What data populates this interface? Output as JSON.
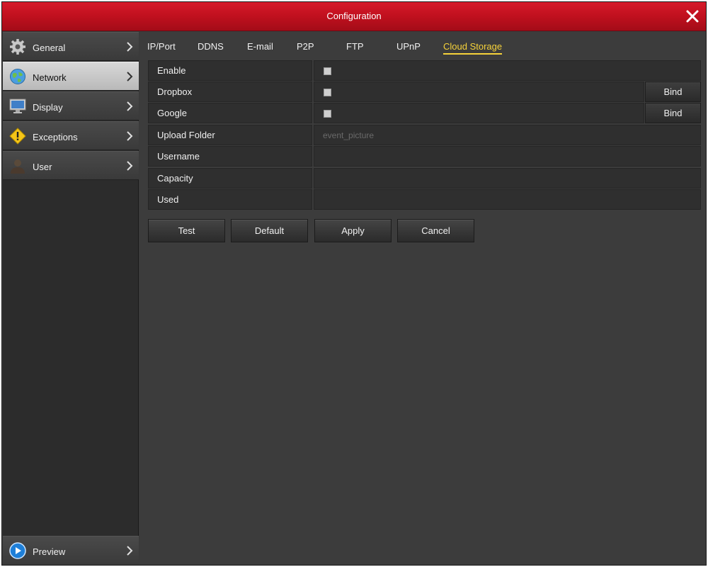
{
  "window": {
    "title": "Configuration"
  },
  "sidebar": {
    "items": [
      {
        "label": "General",
        "icon": "gear-icon"
      },
      {
        "label": "Network",
        "icon": "globe-icon",
        "active": true
      },
      {
        "label": "Display",
        "icon": "monitor-icon"
      },
      {
        "label": "Exceptions",
        "icon": "warning-icon"
      },
      {
        "label": "User",
        "icon": "user-icon"
      }
    ],
    "preview": {
      "label": "Preview",
      "icon": "play-icon"
    }
  },
  "tabs": [
    {
      "label": "IP/Port"
    },
    {
      "label": "DDNS"
    },
    {
      "label": "E-mail"
    },
    {
      "label": "P2P"
    },
    {
      "label": "FTP"
    },
    {
      "label": "UPnP"
    },
    {
      "label": "Cloud Storage",
      "active": true
    }
  ],
  "form": {
    "enable": {
      "label": "Enable",
      "checked": false
    },
    "dropbox": {
      "label": "Dropbox",
      "checked": false,
      "bind_label": "Bind"
    },
    "google": {
      "label": "Google",
      "checked": false,
      "bind_label": "Bind"
    },
    "upload_folder": {
      "label": "Upload Folder",
      "value": "event_picture"
    },
    "username": {
      "label": "Username",
      "value": ""
    },
    "capacity": {
      "label": "Capacity",
      "value": ""
    },
    "used": {
      "label": "Used",
      "value": ""
    }
  },
  "actions": {
    "test": "Test",
    "default": "Default",
    "apply": "Apply",
    "cancel": "Cancel"
  },
  "colors": {
    "titlebar": "#c0101e",
    "active_tab": "#f6d23a",
    "background": "#3c3c3c"
  }
}
